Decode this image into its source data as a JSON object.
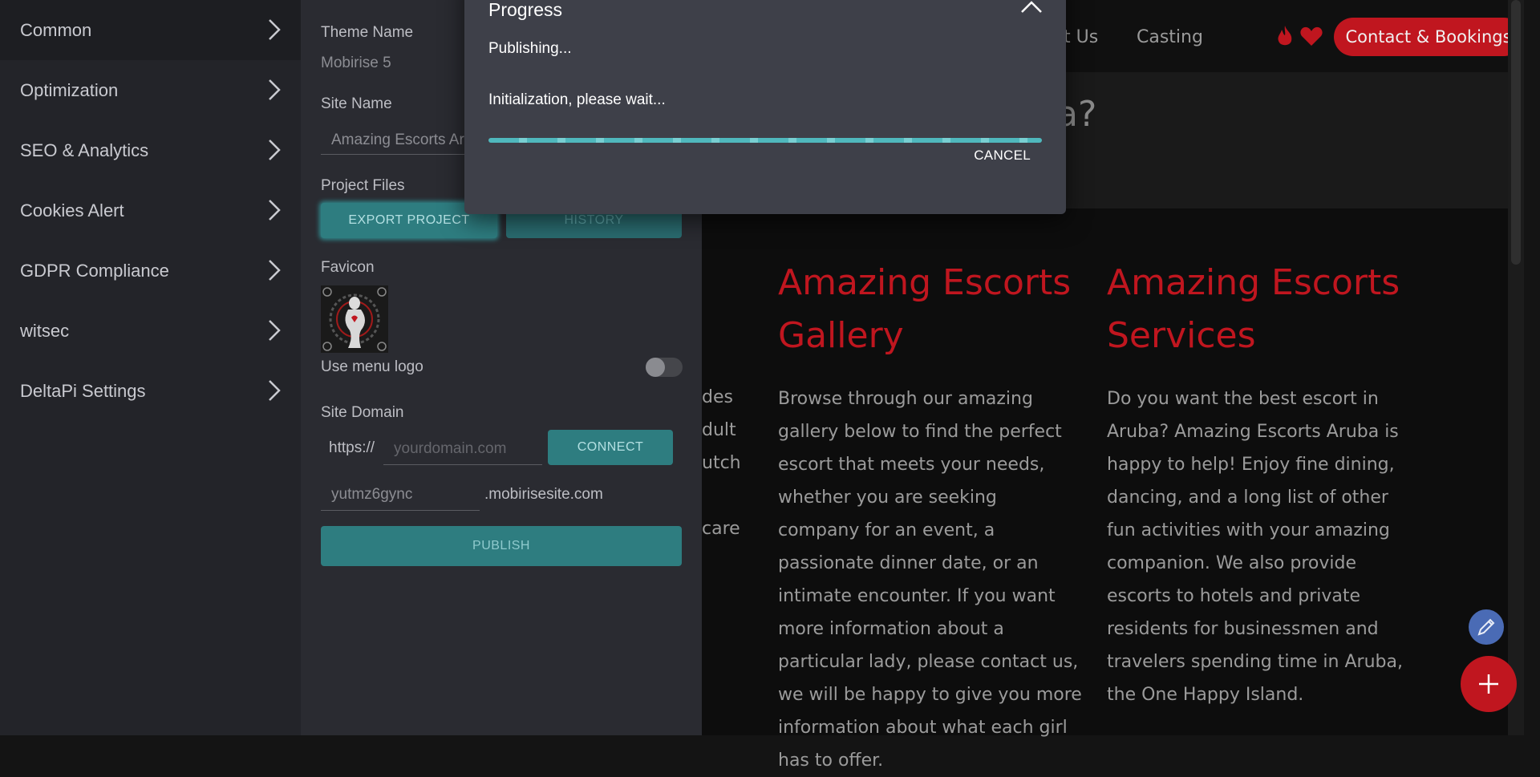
{
  "sidebar": {
    "items": [
      {
        "label": "Common"
      },
      {
        "label": "Optimization"
      },
      {
        "label": "SEO & Analytics"
      },
      {
        "label": "Cookies Alert"
      },
      {
        "label": "GDPR Compliance"
      },
      {
        "label": "witsec"
      },
      {
        "label": "DeltaPi Settings"
      }
    ]
  },
  "settings": {
    "theme_name_label": "Theme Name",
    "theme_name_value": "Mobirise 5",
    "site_name_label": "Site Name",
    "site_name_value": "Amazing Escorts Aruba",
    "project_files_label": "Project Files",
    "export_button": "EXPORT PROJECT",
    "history_button": "HISTORY",
    "favicon_label": "Favicon",
    "use_menu_logo_label": "Use menu logo",
    "use_menu_logo_on": false,
    "site_domain_label": "Site Domain",
    "https_prefix": "https://",
    "domain_placeholder": "yourdomain.com",
    "connect_button": "CONNECT",
    "subdomain_value": "yutmz6gync",
    "subdomain_suffix": ".mobirisesite.com",
    "publish_button": "PUBLISH"
  },
  "dialog": {
    "title": "Progress",
    "status_line": "Publishing...",
    "detail_line": "Initialization, please wait...",
    "cancel_button": "CANCEL",
    "progress_state": "indeterminate"
  },
  "preview": {
    "nav": {
      "about_partial": "t Us",
      "casting": "Casting",
      "contact_button": "Contact & Bookings"
    },
    "hero_partial": "a?",
    "left_fragments": [
      "des",
      "dult",
      "utch",
      "care"
    ],
    "columns": [
      {
        "title": "Amazing Escorts Gallery",
        "body": "Browse through our amazing gallery below to find the perfect escort that meets your needs, whether you are seeking company for an event, a passionate dinner date, or an intimate encounter. If you want more information about a particular lady, please contact us, we will be happy to give you more information about what each girl has to offer."
      },
      {
        "title": "Amazing Escorts Services",
        "body": "Do you want the best escort in Aruba? Amazing Escorts Aruba is happy to help! Enjoy fine dining, dancing, and a long list of other fun activities with your amazing companion. We also provide escorts to hotels and private residents for businessmen and travelers spending time in Aruba, the One Happy Island."
      }
    ]
  },
  "icons": {
    "chevron": "chevron-right-icon",
    "close": "close-icon",
    "fire": "fire-icon",
    "heart": "heart-icon",
    "edit": "pencil-icon",
    "add": "plus-icon"
  },
  "colors": {
    "accent_teal": "#2e7d80",
    "accent_red": "#c0161f",
    "dialog_bg": "#3e4049",
    "sidebar_bg": "#232429"
  }
}
